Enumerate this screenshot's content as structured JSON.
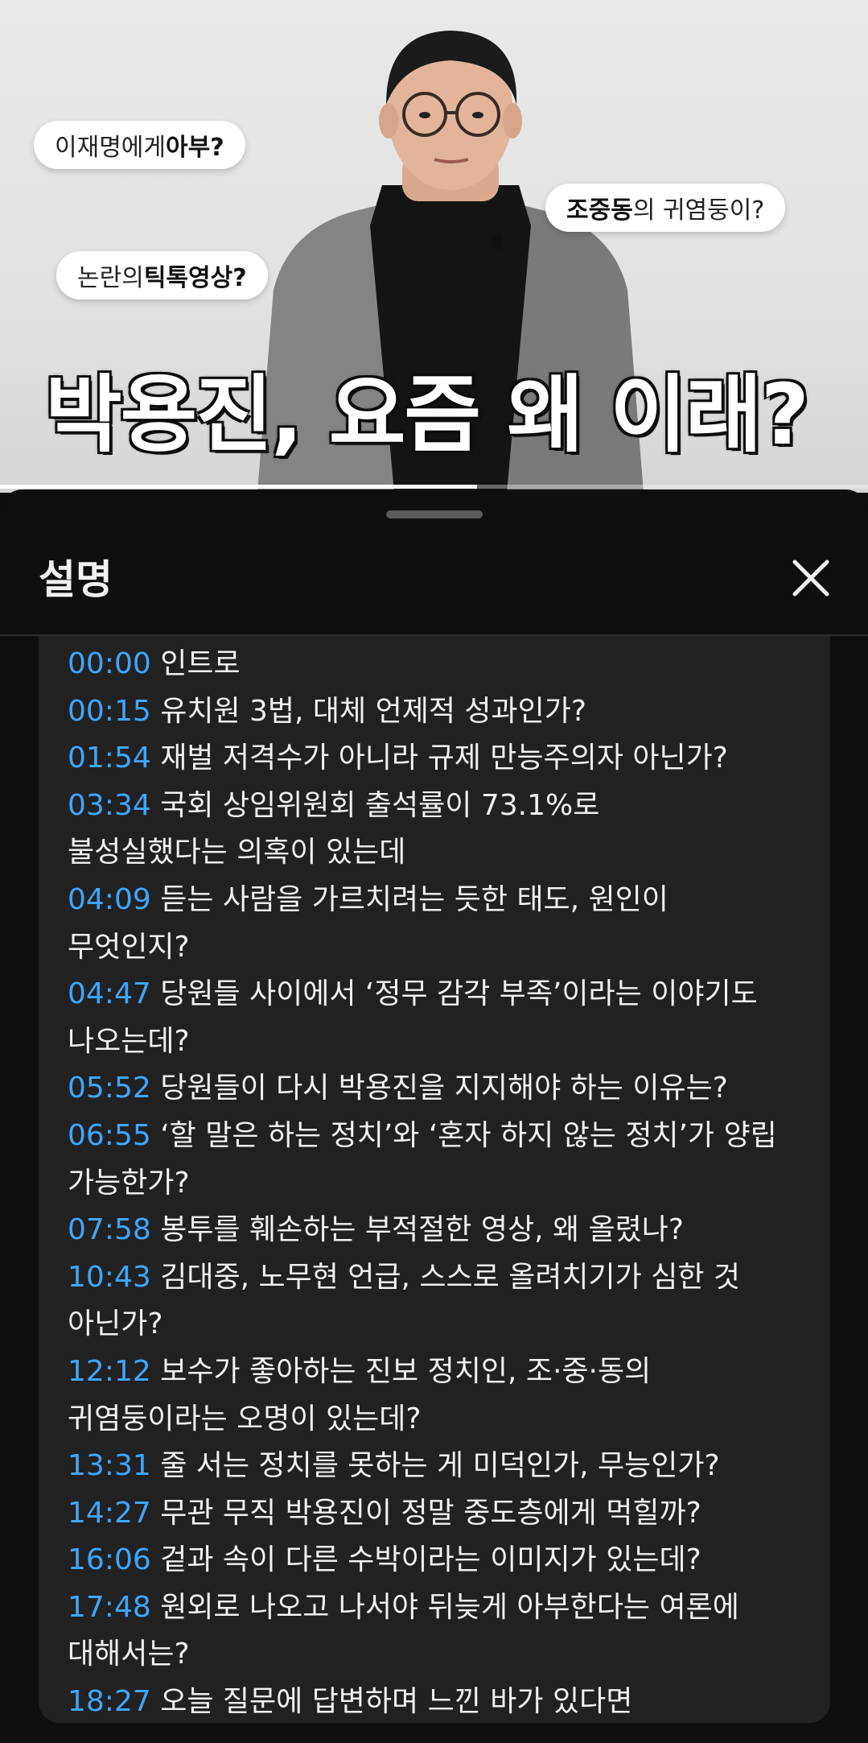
{
  "video": {
    "bubbles": [
      {
        "pre": "이재명에게 ",
        "bold": "아부?",
        "post": ""
      },
      {
        "pre": "",
        "bold": "조중동",
        "post": "의 귀염둥이?"
      },
      {
        "pre": "논란의 ",
        "bold": "틱톡영상?",
        "post": ""
      }
    ],
    "headline": "박용진, 요즘 왜 이래?",
    "progress_percent": 55
  },
  "panel": {
    "title": "설명",
    "close_icon": "close-icon",
    "chapters": [
      {
        "time": "00:00",
        "lines": [
          "인트로"
        ]
      },
      {
        "time": "00:15",
        "lines": [
          "유치원 3법, 대체 언제적 성과인가?"
        ]
      },
      {
        "time": "01:54",
        "lines": [
          "재벌 저격수가 아니라 규제 만능주의자 아닌가?"
        ]
      },
      {
        "time": "03:34",
        "lines": [
          "국회 상임위원회 출석률이 73.1%로",
          "불성실했다는 의혹이 있는데"
        ]
      },
      {
        "time": "04:09",
        "lines": [
          "듣는 사람을 가르치려는 듯한 태도, 원인이",
          "무엇인지?"
        ]
      },
      {
        "time": "04:47",
        "lines": [
          "당원들 사이에서 ‘정무 감각 부족’이라는 이야기도",
          "나오는데?"
        ]
      },
      {
        "time": "05:52",
        "lines": [
          "당원들이 다시 박용진을 지지해야 하는 이유는?"
        ]
      },
      {
        "time": "06:55",
        "lines": [
          "‘할 말은 하는 정치’와 ‘혼자 하지 않는 정치’가 양립",
          "가능한가?"
        ]
      },
      {
        "time": "07:58",
        "lines": [
          "봉투를 훼손하는 부적절한 영상, 왜 올렸나?"
        ]
      },
      {
        "time": "10:43",
        "lines": [
          "김대중, 노무현 언급, 스스로 올려치기가 심한 것",
          "아닌가?"
        ]
      },
      {
        "time": "12:12",
        "lines": [
          "보수가 좋아하는 진보 정치인, 조·중·동의",
          "귀염둥이라는 오명이 있는데?"
        ]
      },
      {
        "time": "13:31",
        "lines": [
          "줄 서는 정치를 못하는 게 미덕인가, 무능인가?"
        ]
      },
      {
        "time": "14:27",
        "lines": [
          "무관 무직 박용진이 정말 중도층에게 먹힐까?"
        ]
      },
      {
        "time": "16:06",
        "lines": [
          "겉과 속이 다른 수박이라는 이미지가 있는데?"
        ]
      },
      {
        "time": "17:48",
        "lines": [
          "원외로 나오고 나서야 뒤늦게 아부한다는 여론에",
          "대해서는?"
        ]
      },
      {
        "time": "18:27",
        "lines": [
          "오늘 질문에 답변하며 느낀 바가 있다면"
        ]
      }
    ],
    "colors": {
      "timestamp": "#3ea6ff",
      "text": "#f1f1f1",
      "panel_bg": "#212121",
      "sheet_bg": "#0f0f0f"
    }
  }
}
